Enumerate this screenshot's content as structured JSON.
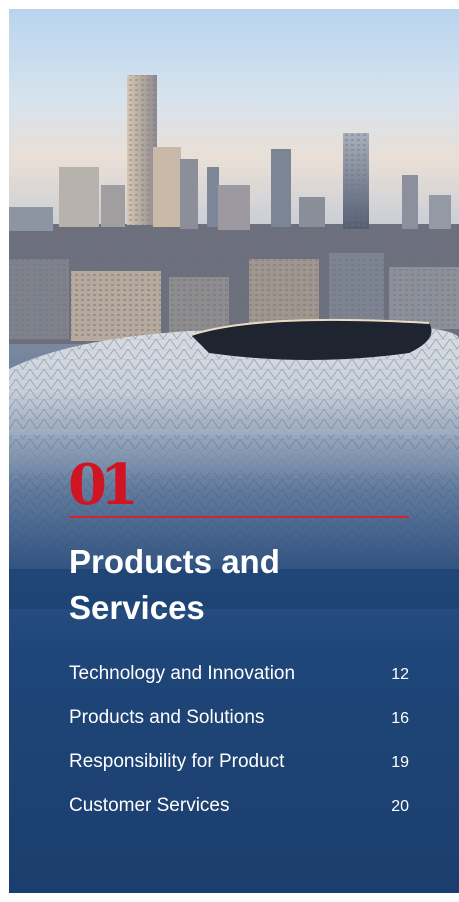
{
  "chapter": {
    "number": "01",
    "title": "Products and Services"
  },
  "contents": [
    {
      "label": "Technology and Innovation",
      "page": "12"
    },
    {
      "label": "Products and Solutions",
      "page": "16"
    },
    {
      "label": "Responsibility for Product",
      "page": "19"
    },
    {
      "label": "Customer Services",
      "page": "20"
    }
  ],
  "colors": {
    "accent_red": "#d01422",
    "navy": "#1b3e6e"
  }
}
